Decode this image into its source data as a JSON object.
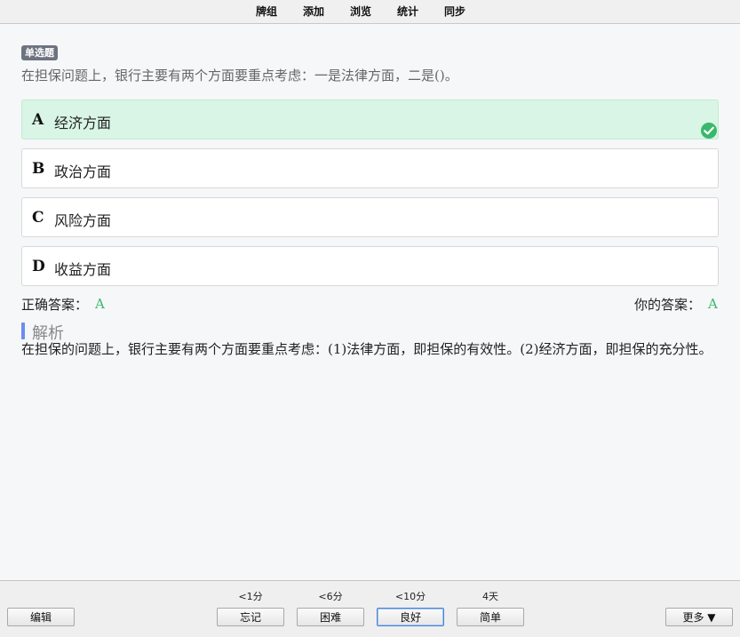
{
  "menu": {
    "decks": "牌组",
    "add": "添加",
    "browse": "浏览",
    "stats": "统计",
    "sync": "同步"
  },
  "card": {
    "type_badge": "单选题",
    "question": "在担保问题上，银行主要有两个方面要重点考虑：一是法律方面，二是()。",
    "options": [
      {
        "letter": "A",
        "text": "经济方面",
        "state": "correct"
      },
      {
        "letter": "B",
        "text": "政治方面",
        "state": "normal"
      },
      {
        "letter": "C",
        "text": "风险方面",
        "state": "normal"
      },
      {
        "letter": "D",
        "text": "收益方面",
        "state": "normal"
      }
    ],
    "correct_answer_label": "正确答案：",
    "correct_answer_value": "A",
    "your_answer_label": "你的答案：",
    "your_answer_value": "A",
    "analysis_title": "解析",
    "analysis_text": "在担保的问题上，银行主要有两个方面要重点考虑：(1)法律方面，即担保的有效性。(2)经济方面，即担保的充分性。"
  },
  "bottom": {
    "edit": "编辑",
    "intervals": [
      "<1分",
      "<6分",
      "<10分",
      "4天"
    ],
    "again": "忘记",
    "hard": "困难",
    "good": "良好",
    "easy": "简单",
    "more": "更多 ▼"
  },
  "colors": {
    "correct_bg": "#d9f5e5",
    "correct_accent": "#39b86c",
    "analysis_accent": "#6a8df0"
  }
}
